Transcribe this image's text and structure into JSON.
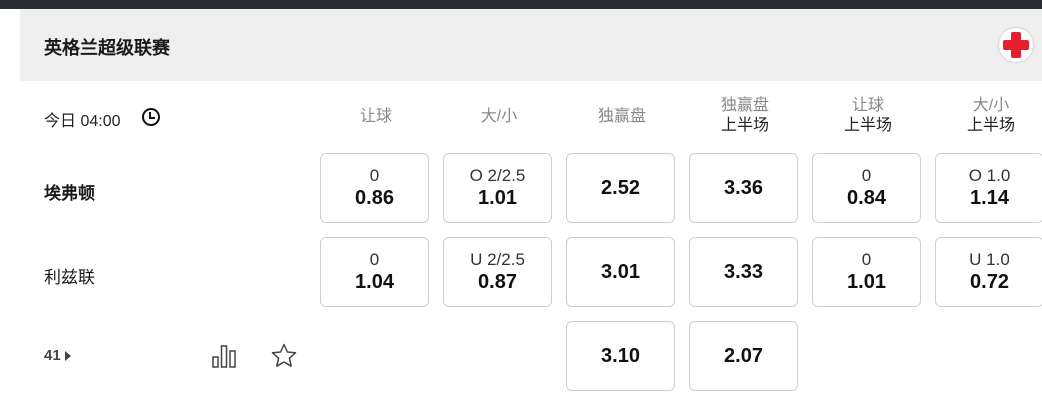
{
  "league": {
    "title": "英格兰超级联赛",
    "flag_icon": "england-flag-icon"
  },
  "match": {
    "time": "今日 04:00",
    "clock_icon": "clock-icon",
    "more_count": "41",
    "home": {
      "name": "埃弗顿"
    },
    "away": {
      "name": "利兹联"
    }
  },
  "columns": [
    {
      "line1": "让球",
      "line2": ""
    },
    {
      "line1": "大/小",
      "line2": ""
    },
    {
      "line1": "独赢盘",
      "line2": ""
    },
    {
      "line1": "独赢盘",
      "line2": "上半场"
    },
    {
      "line1": "让球",
      "line2": "上半场"
    },
    {
      "line1": "大/小",
      "line2": "上半场"
    }
  ],
  "odds": {
    "home": [
      {
        "line": "0",
        "odds": "0.86"
      },
      {
        "line": "O 2/2.5",
        "odds": "1.01"
      },
      {
        "line": "",
        "odds": "2.52"
      },
      {
        "line": "",
        "odds": "3.36"
      },
      {
        "line": "0",
        "odds": "0.84"
      },
      {
        "line": "O 1.0",
        "odds": "1.14"
      }
    ],
    "away": [
      {
        "line": "0",
        "odds": "1.04"
      },
      {
        "line": "U 2/2.5",
        "odds": "0.87"
      },
      {
        "line": "",
        "odds": "3.01"
      },
      {
        "line": "",
        "odds": "3.33"
      },
      {
        "line": "0",
        "odds": "1.01"
      },
      {
        "line": "U 1.0",
        "odds": "0.72"
      }
    ],
    "draw": [
      {
        "odds": "3.10"
      },
      {
        "odds": "2.07"
      }
    ]
  },
  "icons": {
    "stats": "bar-chart-icon",
    "favorite": "star-icon"
  }
}
